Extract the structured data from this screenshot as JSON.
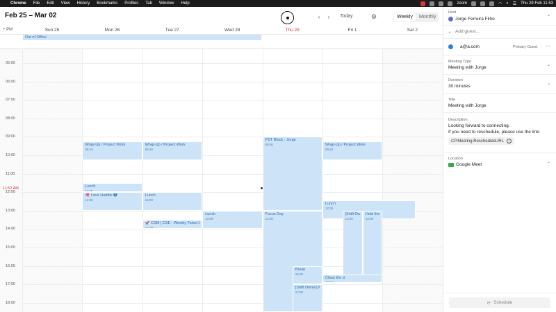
{
  "menubar": {
    "items": [
      "Chrome",
      "File",
      "Edit",
      "View",
      "History",
      "Bookmarks",
      "Profiles",
      "Tab",
      "Window",
      "Help"
    ],
    "app_name": "zoom",
    "clock": "Thu 29 Feb  11:53"
  },
  "header": {
    "range_title": "Feb 25 – Mar 02",
    "today_label": "Today",
    "views": [
      "Weekly",
      "Monthly"
    ],
    "active_view": "Weekly"
  },
  "calendar": {
    "tz_label": "+  PM",
    "days": [
      {
        "label": "Sun 25",
        "today": false
      },
      {
        "label": "Mon 26",
        "today": false
      },
      {
        "label": "Tue 27",
        "today": false
      },
      {
        "label": "Wed 28",
        "today": false
      },
      {
        "label": "Thu 29",
        "today": true
      },
      {
        "label": "Fri 1",
        "today": false
      },
      {
        "label": "Sat 2",
        "today": false
      }
    ],
    "hours": [
      "05:00",
      "06:00",
      "07:00",
      "08:00",
      "09:00",
      "10:00",
      "11:00",
      "12:00",
      "13:00",
      "14:00",
      "15:00",
      "16:00",
      "17:00",
      "18:00"
    ],
    "now_label": "11:52 AM",
    "allday_events": [
      {
        "title": "Out of Office"
      }
    ],
    "events": [
      {
        "title": "Wrap-Up / Project Work",
        "time": "09:15",
        "day": 1,
        "start": 9.25,
        "end": 10.25,
        "col": 0,
        "cols": 1
      },
      {
        "title": "Wrap-Up / Project Work",
        "time": "09:15",
        "day": 2,
        "start": 9.25,
        "end": 10.25,
        "col": 0,
        "cols": 1
      },
      {
        "title": "PST Block - Jorge",
        "time": "09:00",
        "day": 4,
        "start": 9.0,
        "end": 13.0,
        "col": 0,
        "cols": 1
      },
      {
        "title": "Wrap-Up / Project Work",
        "time": "09:15",
        "day": 5,
        "start": 9.25,
        "end": 10.25,
        "col": 0,
        "cols": 1
      },
      {
        "title": "Lunch",
        "time": "11:30",
        "day": 1,
        "start": 11.5,
        "end": 12.0,
        "col": 0,
        "cols": 1
      },
      {
        "title": "💘 Love Huddle 🅑",
        "time": "12:00",
        "day": 1,
        "start": 12.0,
        "end": 13.0,
        "col": 0,
        "cols": 1
      },
      {
        "title": "Lunch",
        "time": "12:00",
        "day": 2,
        "start": 12.0,
        "end": 13.0,
        "col": 0,
        "cols": 1
      },
      {
        "title": "Lunch",
        "time": "12:30",
        "day": 5,
        "start": 12.45,
        "end": 13.45,
        "col": 0,
        "cols": 1.55
      },
      {
        "title": "Lunch",
        "time": "13:00",
        "day": 3,
        "start": 13.0,
        "end": 14.0,
        "col": 0,
        "cols": 1
      },
      {
        "title": "Focus Day",
        "time": "13:00",
        "day": 4,
        "start": 13.0,
        "end": 19.0,
        "col": 0,
        "cols": 1
      },
      {
        "title": "🚀 CSM | CSE - Weekly Ticket Esc",
        "time": "13:30",
        "day": 2,
        "start": 13.5,
        "end": 14.0,
        "col": 0,
        "cols": 1
      },
      {
        "title": "[Shift Owner] AM",
        "time": "13:00",
        "day": 5,
        "start": 13.0,
        "end": 16.8,
        "col": 0.33,
        "cols": 0.34
      },
      {
        "title": "Hold the C",
        "time": "13:00",
        "day": 5,
        "start": 13.0,
        "end": 16.8,
        "col": 0.67,
        "cols": 0.33
      },
      {
        "title": "Break",
        "time": "16:00",
        "day": 4,
        "start": 16.0,
        "end": 17.0,
        "col": 0.5,
        "cols": 0.5
      },
      {
        "title": "[Shift Owner] AM",
        "time": "17:00",
        "day": 4,
        "start": 17.0,
        "end": 19.0,
        "col": 0.5,
        "cols": 0.5
      },
      {
        "title": "Close the d",
        "time": "16:30",
        "day": 5,
        "start": 16.45,
        "end": 16.9,
        "col": 0.0,
        "cols": 1.0
      }
    ]
  },
  "panel": {
    "host_label": "Host",
    "host_name": "Jorge Ferreira Filho",
    "add_guest_placeholder": "Add guest...",
    "guest_email": "a@a.com",
    "guest_role": "Primary Guest",
    "meeting_type_label": "Meeting Type",
    "meeting_type_value": "Meeting with Jorge",
    "duration_label": "Duration",
    "duration_value": "30 minutes",
    "title_label": "Title",
    "title_value": "Meeting with Jorge",
    "description_label": "Description",
    "description_line1": "Looking forward to connecting.",
    "description_line2": "If you need to reschedule, please use the link:",
    "reschedule_chip": "CP.Meeting.RescheduleURL",
    "location_label": "Location",
    "location_value": "Google Meet",
    "schedule_label": "Schedule"
  },
  "colors": {
    "event_bg": "#cde3f7",
    "event_text": "#2b6cb0",
    "today": "#d33333"
  }
}
